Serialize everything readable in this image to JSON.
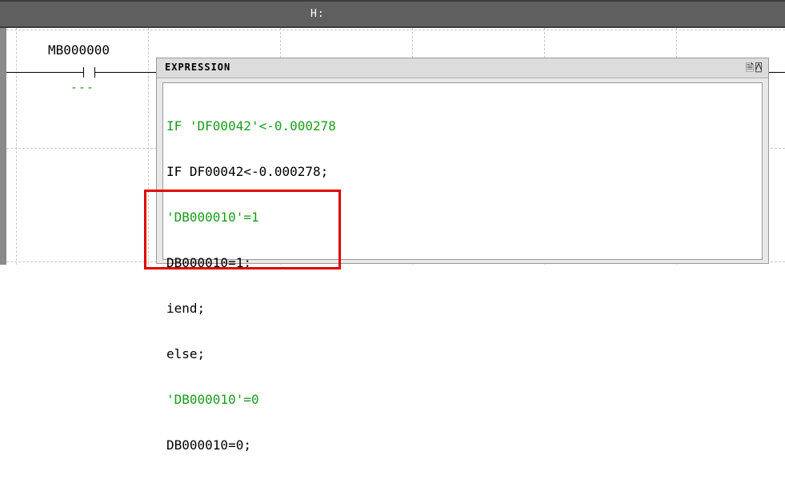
{
  "window": {
    "title": "H:"
  },
  "ladder": {
    "contact_label": "MB000000",
    "contact_status": "---"
  },
  "popup": {
    "title": "EXPRESSION",
    "icons": [
      "document-icon",
      "pin-icon"
    ],
    "lines": [
      {
        "text": "IF 'DF00042'<-0.000278",
        "color": "green"
      },
      {
        "text": "IF DF00042<-0.000278;",
        "color": "black"
      },
      {
        "text": "'DB000010'=1",
        "color": "green"
      },
      {
        "text": "DB000010=1;",
        "color": "black"
      },
      {
        "text": "iend;",
        "color": "black"
      },
      {
        "text": "else;",
        "color": "black"
      },
      {
        "text": "'DB000010'=0",
        "color": "green"
      },
      {
        "text": "DB000010=0;",
        "color": "black"
      }
    ]
  },
  "colors": {
    "title_bar": "#5f5f5f",
    "comment_green": "#1a9c1a",
    "highlight_red": "#e00000"
  }
}
